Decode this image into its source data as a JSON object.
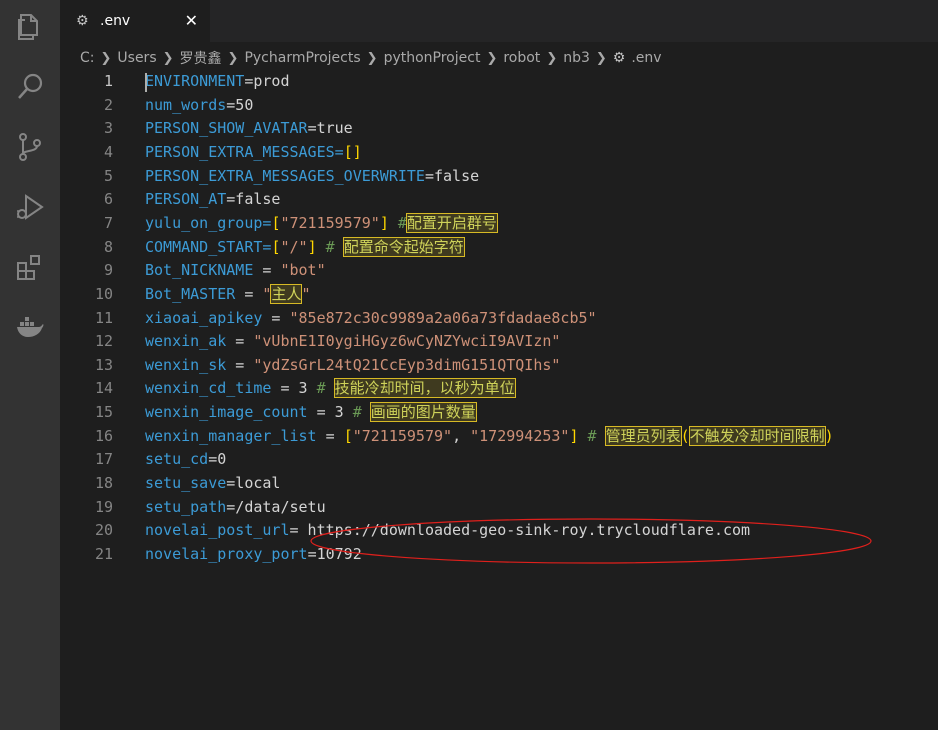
{
  "tab": {
    "label": ".env",
    "close": "✕"
  },
  "breadcrumb": [
    "C:",
    "Users",
    "罗贵鑫",
    "PycharmProjects",
    "pythonProject",
    "robot",
    "nb3",
    ".env"
  ],
  "activity_icons": [
    "files-icon",
    "search-icon",
    "source-control-icon",
    "run-debug-icon",
    "extensions-icon",
    "docker-icon"
  ],
  "lines": [
    [
      {
        "t": "ENVIRONMENT",
        "c": "key"
      },
      {
        "t": "=prod",
        "c": "v"
      }
    ],
    [
      {
        "t": "num_words",
        "c": "key"
      },
      {
        "t": "=50",
        "c": "v"
      }
    ],
    [
      {
        "t": "PERSON_SHOW_AVATAR",
        "c": "key"
      },
      {
        "t": "=true",
        "c": "v"
      }
    ],
    [
      {
        "t": "PERSON_EXTRA_MESSAGES",
        "c": "key"
      },
      {
        "t": "=",
        "c": "key"
      },
      {
        "t": "[]",
        "c": "b"
      }
    ],
    [
      {
        "t": "PERSON_EXTRA_MESSAGES_OVERWRITE",
        "c": "key"
      },
      {
        "t": "=false",
        "c": "v"
      }
    ],
    [
      {
        "t": "PERSON_AT",
        "c": "key"
      },
      {
        "t": "=false",
        "c": "v"
      }
    ],
    [
      {
        "t": "yulu_on_group",
        "c": "key"
      },
      {
        "t": "=",
        "c": "key"
      },
      {
        "t": "[",
        "c": "b"
      },
      {
        "t": "\"721159579\"",
        "c": "s"
      },
      {
        "t": "]",
        "c": "b"
      },
      {
        "t": " #",
        "c": "c"
      },
      {
        "t": "配置开启群号",
        "c": "hl"
      }
    ],
    [
      {
        "t": "COMMAND_START",
        "c": "key"
      },
      {
        "t": "=",
        "c": "key"
      },
      {
        "t": "[",
        "c": "b"
      },
      {
        "t": "\"/\"",
        "c": "s"
      },
      {
        "t": "]",
        "c": "b"
      },
      {
        "t": " # ",
        "c": "c"
      },
      {
        "t": "配置命令起始字符",
        "c": "hl"
      }
    ],
    [
      {
        "t": "Bot_NICKNAME",
        "c": "key"
      },
      {
        "t": " = ",
        "c": "v"
      },
      {
        "t": "\"bot\"",
        "c": "s"
      }
    ],
    [
      {
        "t": "Bot_MASTER",
        "c": "key"
      },
      {
        "t": " = ",
        "c": "v"
      },
      {
        "t": "\"",
        "c": "s"
      },
      {
        "t": "主人",
        "c": "hl"
      },
      {
        "t": "\"",
        "c": "s"
      }
    ],
    [
      {
        "t": "xiaoai_apikey",
        "c": "key"
      },
      {
        "t": " = ",
        "c": "v"
      },
      {
        "t": "\"85e872c30c9989a2a06a73fdadae8cb5\"",
        "c": "s"
      }
    ],
    [
      {
        "t": "wenxin_ak",
        "c": "key"
      },
      {
        "t": " = ",
        "c": "v"
      },
      {
        "t": "\"vUbnE1I0ygiHGyz6wCyNZYwciI9AVIzn\"",
        "c": "s"
      }
    ],
    [
      {
        "t": "wenxin_sk",
        "c": "key"
      },
      {
        "t": " = ",
        "c": "v"
      },
      {
        "t": "\"ydZsGrL24tQ21CcEyp3dimG151QTQIhs\"",
        "c": "s"
      }
    ],
    [
      {
        "t": "wenxin_cd_time",
        "c": "key"
      },
      {
        "t": " = 3 ",
        "c": "v"
      },
      {
        "t": "# ",
        "c": "c"
      },
      {
        "t": "技能冷却时间，以秒为单位",
        "c": "hl"
      }
    ],
    [
      {
        "t": "wenxin_image_count",
        "c": "key"
      },
      {
        "t": " = 3 ",
        "c": "v"
      },
      {
        "t": "# ",
        "c": "c"
      },
      {
        "t": "画画的图片数量",
        "c": "hl"
      }
    ],
    [
      {
        "t": "wenxin_manager_list",
        "c": "key"
      },
      {
        "t": " = ",
        "c": "v"
      },
      {
        "t": "[",
        "c": "b"
      },
      {
        "t": "\"721159579\"",
        "c": "s"
      },
      {
        "t": ", ",
        "c": "v"
      },
      {
        "t": "\"172994253\"",
        "c": "s"
      },
      {
        "t": "]",
        "c": "b"
      },
      {
        "t": " # ",
        "c": "c"
      },
      {
        "t": "管理员列表",
        "c": "hl"
      },
      {
        "t": "(",
        "c": "b"
      },
      {
        "t": "不触发冷却时间限制",
        "c": "hl"
      },
      {
        "t": ")",
        "c": "b"
      }
    ],
    [
      {
        "t": "setu_cd",
        "c": "key"
      },
      {
        "t": "=0",
        "c": "v"
      }
    ],
    [
      {
        "t": "setu_save",
        "c": "key"
      },
      {
        "t": "=local",
        "c": "v"
      }
    ],
    [
      {
        "t": "setu_path",
        "c": "key"
      },
      {
        "t": "=/data/setu",
        "c": "v"
      }
    ],
    [
      {
        "t": "novelai_post_url",
        "c": "key"
      },
      {
        "t": "= https://downloaded-geo-sink-roy.trycloudflare.com",
        "c": "v"
      }
    ],
    [
      {
        "t": "novelai_proxy_port",
        "c": "key"
      },
      {
        "t": "=10792",
        "c": "v"
      }
    ]
  ],
  "colors": {
    "ellipse": "#e0201c",
    "highlight_border": "#d7ba25"
  }
}
